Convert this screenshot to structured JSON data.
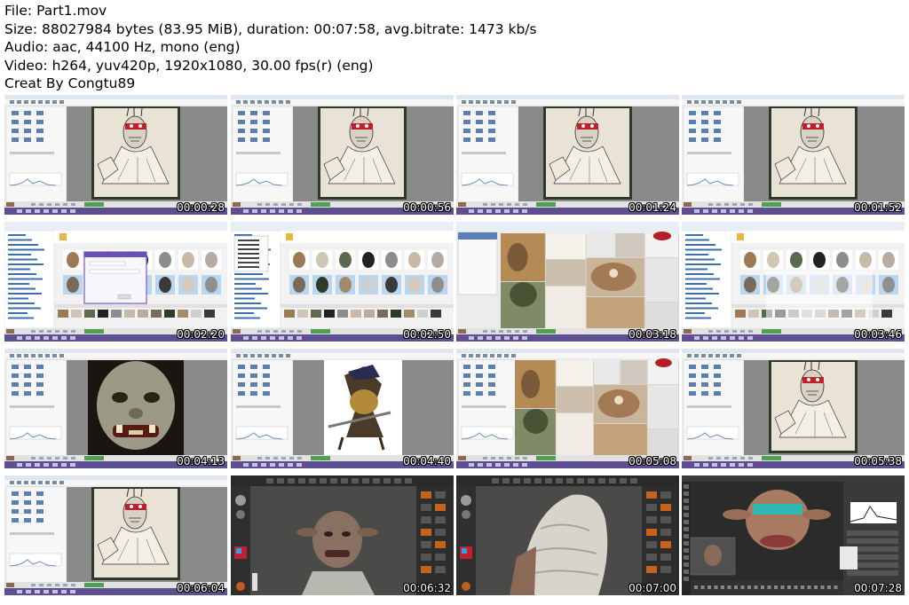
{
  "header": {
    "file": "File: Part1.mov",
    "size": "Size: 88027984 bytes (83.95 MiB), duration: 00:07:58, avg.bitrate: 1473 kb/s",
    "audio": "Audio: aac, 44100 Hz, mono (eng)",
    "video": "Video: h264, yuv420p, 1920x1080, 30.00 fps(r) (eng)",
    "credit": "Creat By Congtu89"
  },
  "thumbnails": [
    {
      "time": "00:00:28",
      "scene": "image-viewer-orc-drawing"
    },
    {
      "time": "00:00:56",
      "scene": "image-viewer-orc-drawing"
    },
    {
      "time": "00:01:24",
      "scene": "image-viewer-orc-drawing"
    },
    {
      "time": "00:01:52",
      "scene": "image-viewer-orc-drawing"
    },
    {
      "time": "00:02:20",
      "scene": "file-browser-dialog"
    },
    {
      "time": "00:02:50",
      "scene": "file-browser-menu"
    },
    {
      "time": "00:03:18",
      "scene": "reference-collage"
    },
    {
      "time": "00:03:46",
      "scene": "file-browser-faded"
    },
    {
      "time": "00:04:13",
      "scene": "image-viewer-orc-mask"
    },
    {
      "time": "00:04:40",
      "scene": "image-viewer-warrior"
    },
    {
      "time": "00:05:08",
      "scene": "reference-collage-viewer"
    },
    {
      "time": "00:05:38",
      "scene": "image-viewer-orc-drawing"
    },
    {
      "time": "00:06:04",
      "scene": "image-viewer-orc-drawing"
    },
    {
      "time": "00:06:32",
      "scene": "sculpt-app-bust"
    },
    {
      "time": "00:07:00",
      "scene": "sculpt-app-armor"
    },
    {
      "time": "00:07:28",
      "scene": "paint-app-face"
    }
  ]
}
